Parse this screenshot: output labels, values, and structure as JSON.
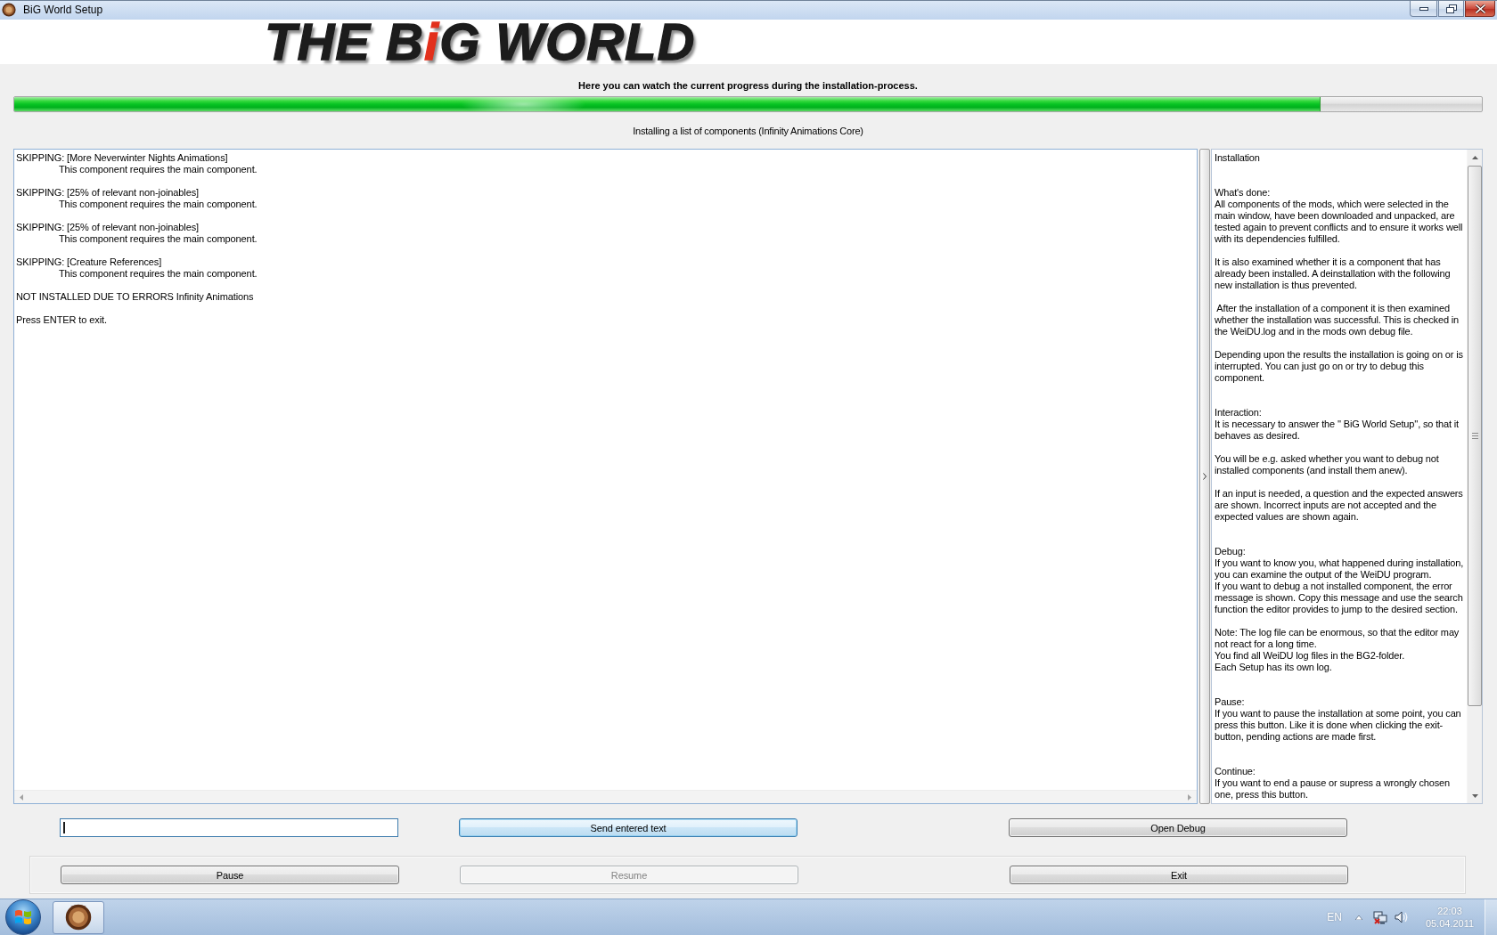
{
  "window": {
    "title": "BiG World Setup"
  },
  "logo": {
    "parts": [
      {
        "text": "THE B",
        "color": "#1c1c1c"
      },
      {
        "text": "i",
        "color": "#e2301c"
      },
      {
        "text": "G WORLD",
        "color": "#1c1c1c"
      }
    ]
  },
  "progress": {
    "caption": "Here you can watch the current progress during the installation-process.",
    "level": 0.89,
    "status": "Installing a list of components (Infinity Animations Core)"
  },
  "log": {
    "entries": [
      {
        "line": "SKIPPING: [More Neverwinter Nights Animations]",
        "detail": "This component requires the main component."
      },
      {
        "line": "SKIPPING: [25% of relevant non-joinables]",
        "detail": "This component requires the main component."
      },
      {
        "line": "SKIPPING: [25% of relevant non-joinables]",
        "detail": "This component requires the main component."
      },
      {
        "line": "SKIPPING: [Creature References]",
        "detail": "This component requires the main component."
      },
      {
        "line": "NOT INSTALLED DUE TO ERRORS Infinity Animations"
      },
      {
        "line": "Press ENTER to exit."
      }
    ]
  },
  "help": {
    "blocks": [
      {
        "kind": "title",
        "text": "Installation"
      },
      {
        "kind": "heading",
        "text": "What's done:"
      },
      {
        "kind": "paragraph",
        "text": "All components of the mods, which were selected in the\nmain window, have been downloaded and unpacked, are\ntested again to prevent conflicts and to ensure it works well\nwith its dependencies fulfilled."
      },
      {
        "kind": "paragraph",
        "text": "It is also examined whether it is a component that has\nalready been installed. A deinstallation with the following\nnew installation is thus prevented."
      },
      {
        "kind": "paragraph",
        "text": " After the installation of a component it is then examined\nwhether the installation was successful. This is checked in\nthe WeiDU.log and in the mods own debug file."
      },
      {
        "kind": "paragraph",
        "text": "Depending upon the results the installation is going on or is\ninterrupted. You can just go on or try to debug this\ncomponent."
      },
      {
        "kind": "heading",
        "text": "Interaction:"
      },
      {
        "kind": "paragraph",
        "text": "It is necessary to answer the '' BiG World Setup'', so that it\nbehaves as desired."
      },
      {
        "kind": "paragraph",
        "text": "You will be e.g. asked whether you want to debug not\ninstalled components (and install them anew)."
      },
      {
        "kind": "paragraph",
        "text": "If an input is needed, a question and the expected answers\nare shown. Incorrect inputs are not accepted and the\nexpected values are shown again."
      },
      {
        "kind": "heading",
        "text": "Debug:"
      },
      {
        "kind": "paragraph",
        "text": "If you want to know you, what happened during installation,\nyou can examine the output of the WeiDU program.\nIf you want to debug a not installed component, the error\nmessage is shown. Copy this message and use the search\nfunction the editor provides to jump to the desired section."
      },
      {
        "kind": "paragraph",
        "text": "Note: The log file can be enormous, so that the editor may\nnot react for a long time.\nYou find all WeiDU log files in the BG2-folder.\nEach Setup has its own log."
      },
      {
        "kind": "heading",
        "text": "Pause:"
      },
      {
        "kind": "paragraph",
        "text": "If you want to pause the installation at some point, you can\npress this button. Like it is done when clicking the exit-\nbutton, pending actions are made first."
      },
      {
        "kind": "heading",
        "text": "Continue:"
      },
      {
        "kind": "paragraph",
        "text": "If you want to end a pause or supress a wrongly chosen\none, press this button."
      }
    ]
  },
  "input": {
    "focused": true
  },
  "actions": [
    {
      "label": "Send entered text",
      "focused": true
    },
    {
      "label": "Open Debug",
      "focused": false
    }
  ],
  "controls": [
    {
      "label": "Pause",
      "disabled": false
    },
    {
      "label": "Resume",
      "disabled": true
    },
    {
      "label": "Exit",
      "disabled": false
    }
  ],
  "taskbar": {
    "language": "EN",
    "time": "22:03",
    "date": "05.04.2011"
  }
}
